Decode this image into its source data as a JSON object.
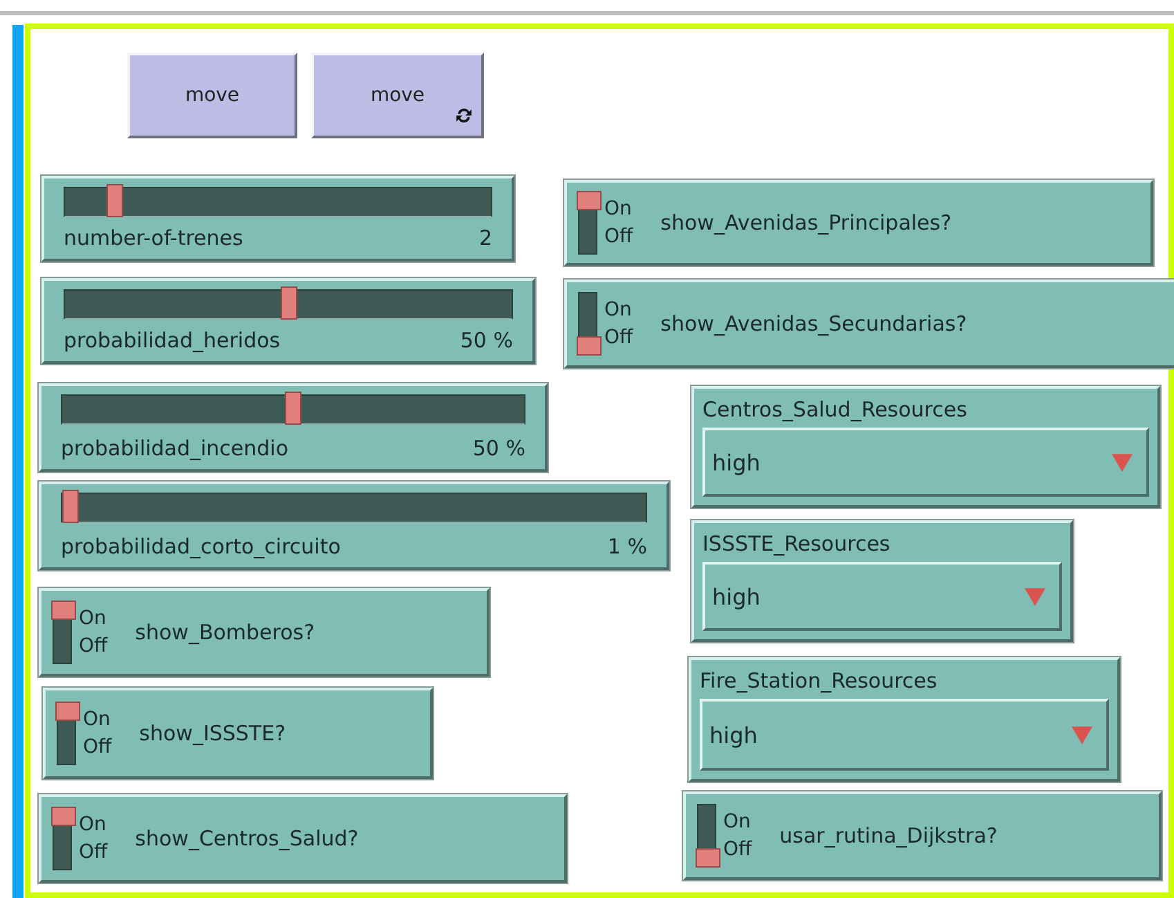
{
  "widgets": [
    {
      "kind": "button",
      "label": "move",
      "forever": false
    },
    {
      "kind": "button",
      "label": "move",
      "forever": true
    },
    {
      "kind": "slider",
      "label": "number-of-trenes",
      "value": "2",
      "level": 0.1
    },
    {
      "kind": "switch",
      "label": "show_Avenidas_Principales?",
      "on_label": "On",
      "off_label": "Off",
      "on": true
    },
    {
      "kind": "slider",
      "label": "probabilidad_heridos",
      "value": "50 %",
      "level": 0.5
    },
    {
      "kind": "switch",
      "label": "show_Avenidas_Secundarias?",
      "on_label": "On",
      "off_label": "Off",
      "on": false
    },
    {
      "kind": "slider",
      "label": "probabilidad_incendio",
      "value": "50 %",
      "level": 0.5
    },
    {
      "kind": "chooser",
      "label": "Centros_Salud_Resources",
      "value": "high"
    },
    {
      "kind": "slider",
      "label": "probabilidad_corto_circuito",
      "value": "1 %",
      "level": 0.0
    },
    {
      "kind": "chooser",
      "label": "ISSSTE_Resources",
      "value": "high"
    },
    {
      "kind": "switch",
      "label": "show_Bomberos?",
      "on_label": "On",
      "off_label": "Off",
      "on": true
    },
    {
      "kind": "switch",
      "label": "show_ISSSTE?",
      "on_label": "On",
      "off_label": "Off",
      "on": true
    },
    {
      "kind": "chooser",
      "label": "Fire_Station_Resources",
      "value": "high"
    },
    {
      "kind": "switch",
      "label": "show_Centros_Salud?",
      "on_label": "On",
      "off_label": "Off",
      "on": true
    },
    {
      "kind": "switch",
      "label": "usar_rutina_Dijkstra?",
      "on_label": "On",
      "off_label": "Off",
      "on": false
    }
  ]
}
